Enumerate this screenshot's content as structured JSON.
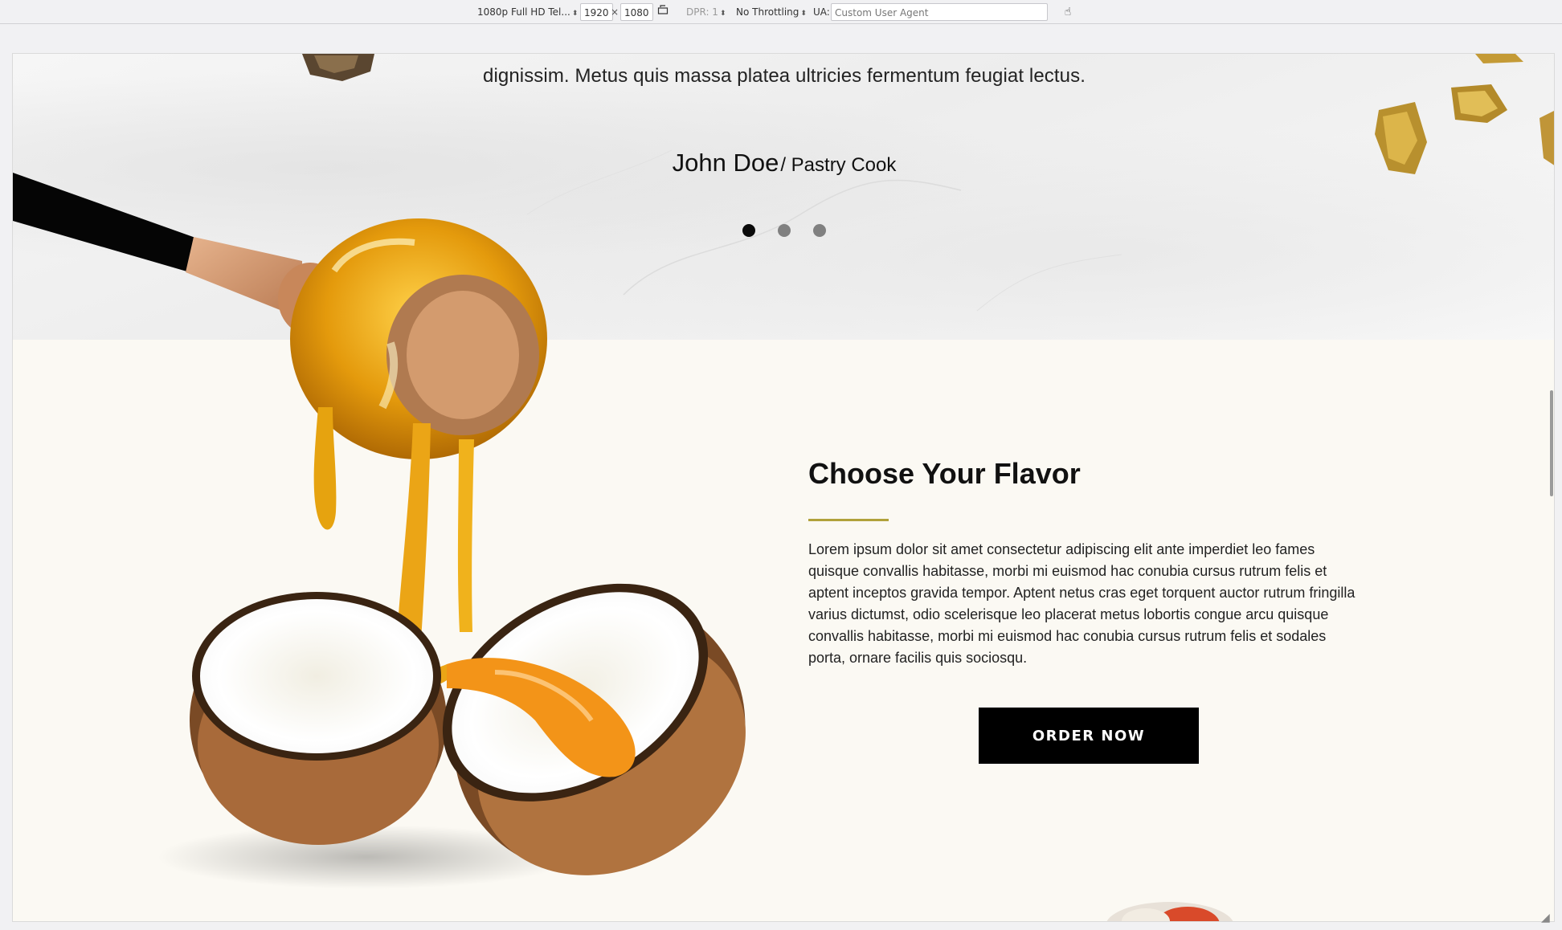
{
  "toolbar": {
    "device": "1080p Full HD Tel...",
    "width": "1920",
    "times": "×",
    "height": "1080",
    "dpr": "DPR: 1",
    "throttling": "No Throttling",
    "ua_label": "UA:",
    "ua_placeholder": "Custom User Agent"
  },
  "testimonial": {
    "quote_tail": "dignissim. Metus quis massa platea ultricies fermentum feugiat lectus.",
    "author_name": "John Doe",
    "author_role": "/ Pastry Cook",
    "slides": 3,
    "active_slide": 1
  },
  "feature": {
    "title": "Choose Your Flavor",
    "text": "Lorem ipsum dolor sit amet consectetur adipiscing elit ante imperdiet leo fames quisque convallis habitasse, morbi mi euismod hac conubia cursus rutrum felis et aptent inceptos gravida tempor. Aptent netus cras eget torquent auctor rutrum fringilla varius dictumst, odio scelerisque leo placerat metus lobortis congue arcu quisque convallis habitasse, morbi mi euismod hac conubia cursus rutrum felis et sodales porta, ornare facilis quis sociosqu.",
    "button": "ORDER NOW"
  },
  "colors": {
    "accent": "#b1a13a",
    "button_bg": "#000000",
    "section_bg": "#fbf9f3",
    "dot_active": "#0a0a0a",
    "dot_inactive": "#808080"
  },
  "icons": {
    "rotate": "rotate-icon",
    "touch": "touch-icon"
  }
}
